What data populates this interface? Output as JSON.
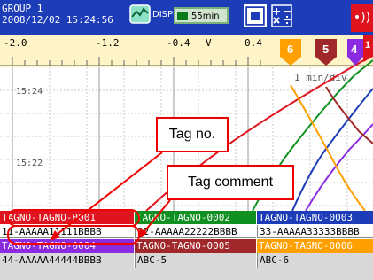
{
  "header": {
    "group": "GROUP 1",
    "datetime": "2008/12/02 15:24:56",
    "disp_label": "DISP",
    "rate": "55min",
    "alarm_glyph": "•))"
  },
  "scale": {
    "ticks": [
      "-2.0",
      "-1.2",
      "-0.4",
      "0.4"
    ],
    "unit": "V"
  },
  "chart": {
    "time_labels": [
      "15:24",
      "15:22"
    ],
    "rate_label": "1 min/div",
    "channel_markers": [
      "6",
      "5",
      "4",
      "1"
    ],
    "colors": {
      "ch1": "#e0141e",
      "ch2": "#109020",
      "ch3": "#1c3cb8",
      "ch4": "#8a2be2",
      "ch5": "#a0282a",
      "ch6": "#ffa000"
    }
  },
  "tags": [
    {
      "tag": "TAGNO-TAGNO-0001",
      "comment": "11-AAAAA11111BBBB",
      "color": "#e0141e",
      "text": "#ffffff"
    },
    {
      "tag": "TAGNO-TAGNO-0002",
      "comment": "22-AAAAA22222BBBB",
      "color": "#109020",
      "text": "#ffffff"
    },
    {
      "tag": "TAGNO-TAGNO-0003",
      "comment": "33-AAAAA33333BBBB",
      "color": "#1c3cb8",
      "text": "#ffffff"
    },
    {
      "tag": "TAGNO-TAGNO-0004",
      "comment": "44-AAAAA44444BBBB",
      "color": "#8a2be2",
      "text": "#ffffff"
    },
    {
      "tag": "TAGNO-TAGNO-0005",
      "comment": "ABC-5",
      "color": "#a0282a",
      "text": "#ffffff"
    },
    {
      "tag": "TAGNO-TAGNO-0006",
      "comment": "ABC-6",
      "color": "#ffa000",
      "text": "#ffffff"
    }
  ],
  "callouts": {
    "tag_no": "Tag no.",
    "tag_comment": "Tag comment"
  }
}
